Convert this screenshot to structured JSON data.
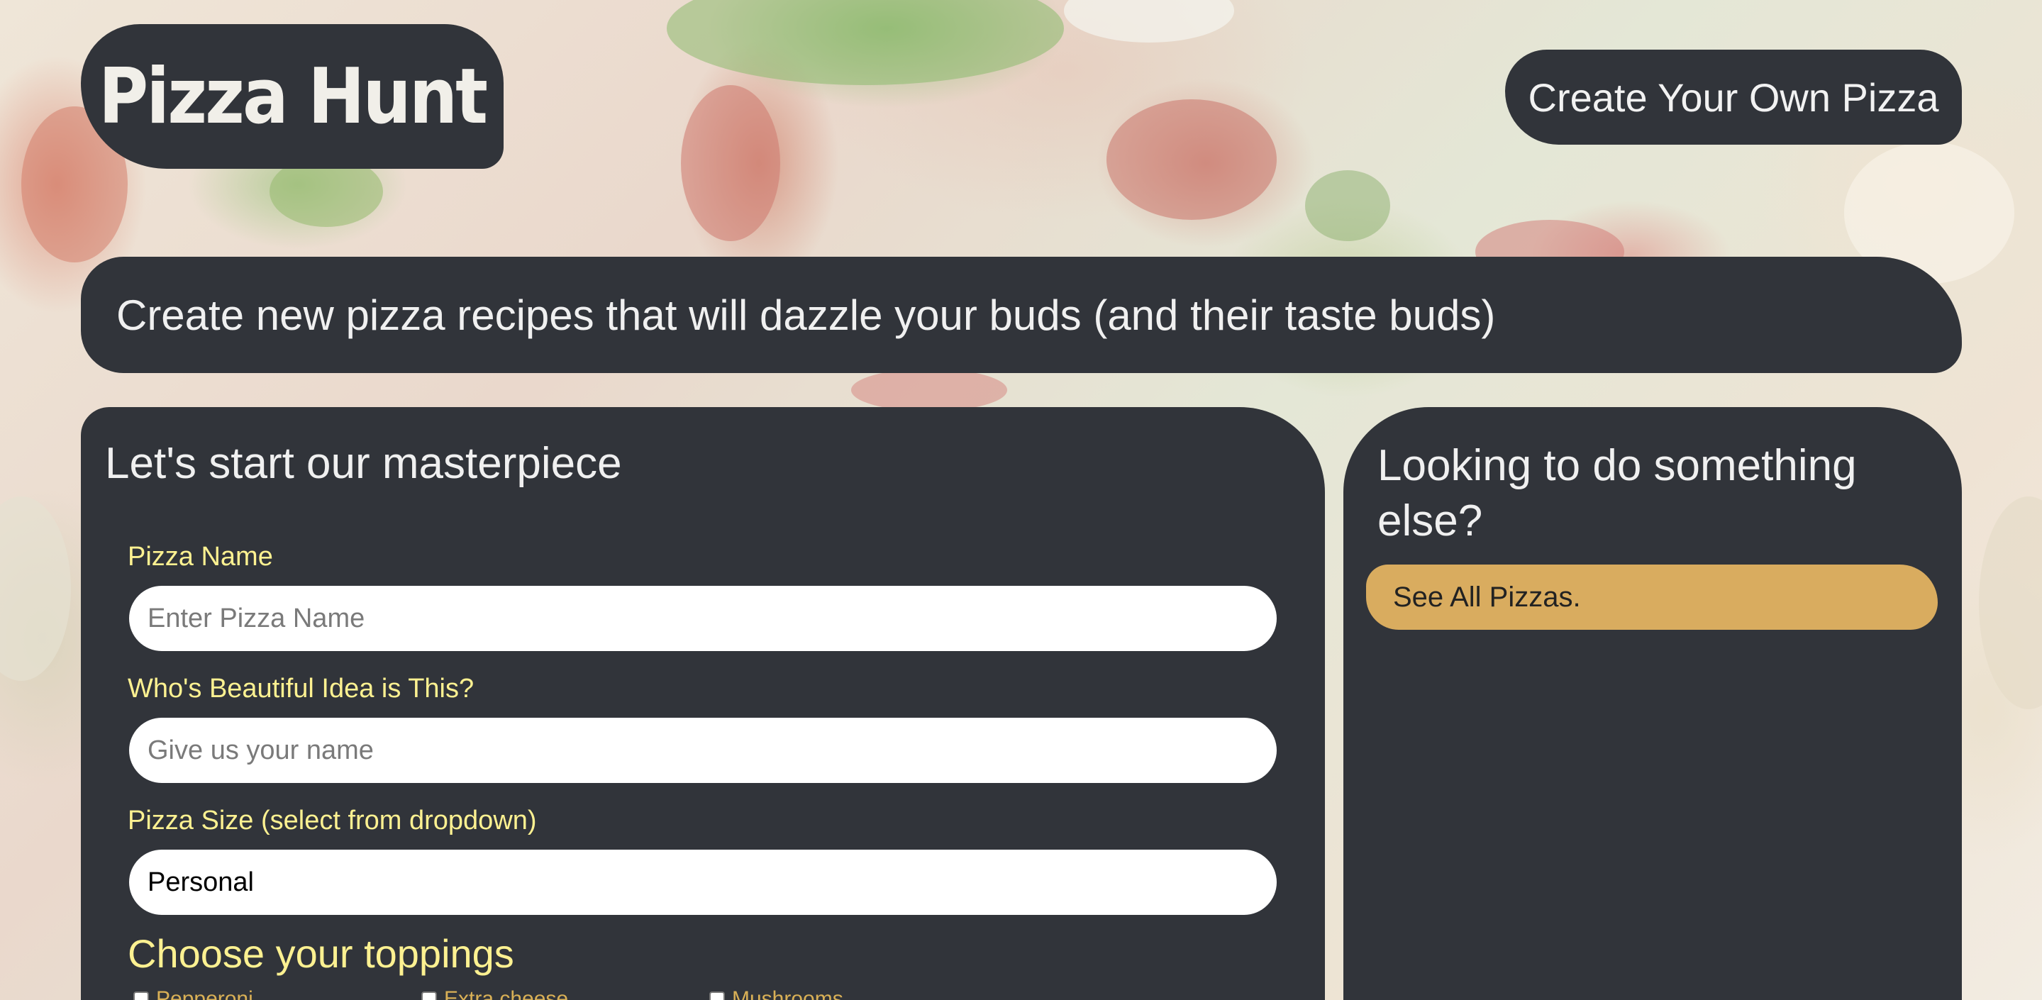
{
  "header": {
    "logo_text": "Pizza Hunt",
    "create_button_label": "Create Your Own Pizza"
  },
  "banner": {
    "text": "Create new pizza recipes that will dazzle your buds (and their taste buds)"
  },
  "form": {
    "title": "Let's start our masterpiece",
    "pizza_name": {
      "label": "Pizza Name",
      "placeholder": "Enter Pizza Name",
      "value": ""
    },
    "creator": {
      "label": "Who's Beautiful Idea is This?",
      "placeholder": "Give us your name",
      "value": ""
    },
    "size": {
      "label": "Pizza Size (select from dropdown)",
      "selected": "Personal"
    },
    "toppings": {
      "title": "Choose your toppings",
      "items": [
        {
          "label": "Pepperoni",
          "checked": false
        },
        {
          "label": "Extra cheese",
          "checked": false
        },
        {
          "label": "Mushrooms",
          "checked": false
        }
      ]
    }
  },
  "sidebar": {
    "title": "Looking to do something else?",
    "see_all_label": "See All Pizzas."
  },
  "colors": {
    "panel": "#31343a",
    "label_yellow": "#fdf191",
    "accent_gold": "#d9ac5f",
    "topping_text": "#d9b056"
  }
}
